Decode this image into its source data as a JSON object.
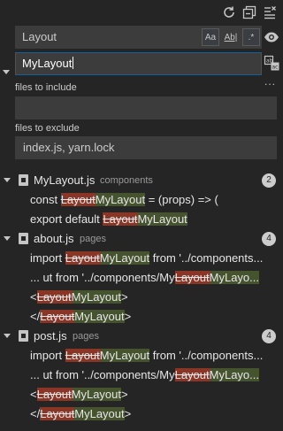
{
  "toolbar": {
    "icons": [
      "refresh-icon",
      "collapse-all-icon",
      "clear-results-icon"
    ]
  },
  "search": {
    "value": "Layout",
    "options": {
      "match_case": "Aa",
      "whole_word": "Ab|",
      "regex": ".*"
    }
  },
  "replace": {
    "value": "MyLayout"
  },
  "include": {
    "label": "files to include",
    "value": ""
  },
  "exclude": {
    "label": "files to exclude",
    "value": "index.js, yarn.lock"
  },
  "more_label": "...",
  "colors": {
    "background": "#252526",
    "input": "#3c3c3c",
    "focus_border": "#0e639c",
    "deleted": "#a8402a",
    "inserted": "#4b5a32"
  },
  "results": [
    {
      "file": "MyLayout.js",
      "dir": "components",
      "count": "2",
      "matches": [
        {
          "pre": "const ",
          "del": "Layout",
          "ins": "MyLayout",
          "post": " = (props) => ("
        },
        {
          "pre": "export default ",
          "del": "Layout",
          "ins": "MyLayout",
          "post": ""
        }
      ]
    },
    {
      "file": "about.js",
      "dir": "pages",
      "count": "4",
      "matches": [
        {
          "pre": "import ",
          "del": "Layout",
          "ins": "MyLayout",
          "post": " from '../components..."
        },
        {
          "pre": "... ut from '../components/My",
          "del": "Layout",
          "ins": "MyLayo...",
          "post": ""
        },
        {
          "pre": "<",
          "del": "Layout",
          "ins": "MyLayout",
          "post": ">"
        },
        {
          "pre": "</",
          "del": "Layout",
          "ins": "MyLayout",
          "post": ">"
        }
      ]
    },
    {
      "file": "post.js",
      "dir": "pages",
      "count": "4",
      "matches": [
        {
          "pre": "import ",
          "del": "Layout",
          "ins": "MyLayout",
          "post": " from '../components..."
        },
        {
          "pre": "... ut from '../components/My",
          "del": "Layout",
          "ins": "MyLayo...",
          "post": ""
        },
        {
          "pre": "<",
          "del": "Layout",
          "ins": "MyLayout",
          "post": ">"
        },
        {
          "pre": "</",
          "del": "Layout",
          "ins": "MyLayout",
          "post": ">"
        }
      ]
    }
  ]
}
